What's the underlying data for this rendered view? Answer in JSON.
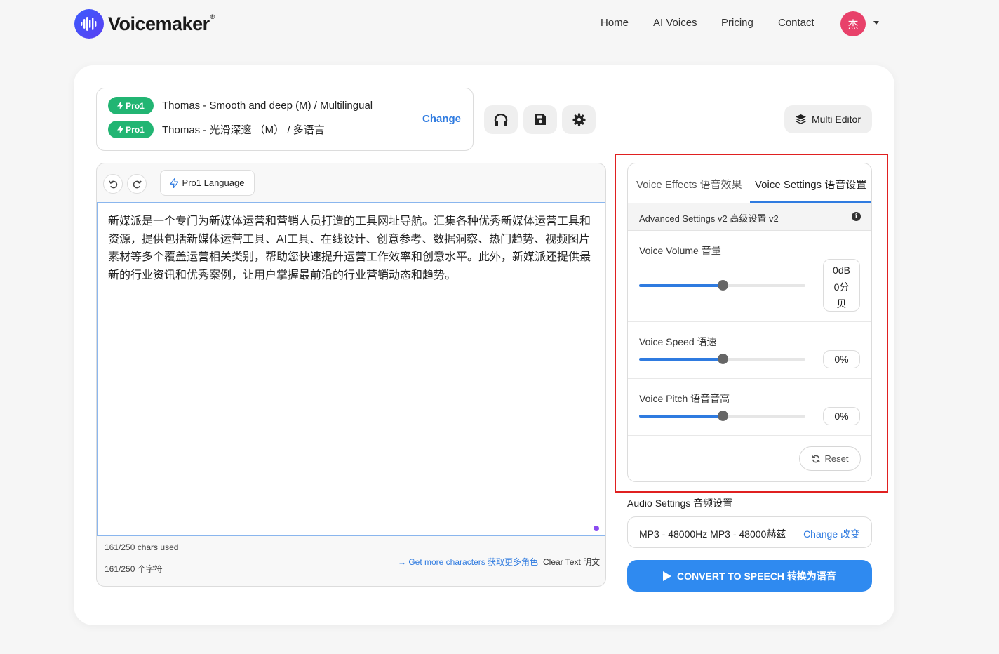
{
  "header": {
    "logo_text": "Voicemaker",
    "logo_reg": "®",
    "nav": [
      "Home",
      "AI Voices",
      "Pricing",
      "Contact"
    ],
    "avatar_initial": "杰"
  },
  "voice": {
    "badge": "Pro1",
    "line1": "Thomas - Smooth and deep (M) / Multilingual",
    "line2": "Thomas - 光滑深邃 （M） / 多语言",
    "change": "Change"
  },
  "toolbar": {
    "multi_editor": "Multi Editor"
  },
  "editor": {
    "language_button": "Pro1 Language",
    "text": "新媒派是一个专门为新媒体运营和营销人员打造的工具网址导航。汇集各种优秀新媒体运营工具和资源，提供包括新媒体运营工具、AI工具、在线设计、创意参考、数据洞察、热门趋势、视频图片素材等多个覆盖运营相关类别，帮助您快速提升运营工作效率和创意水平。此外，新媒派还提供最新的行业资讯和优秀案例，让用户掌握最前沿的行业营销动态和趋势。",
    "chars_used": "161/250 chars used",
    "chars_used_cn": "161/250 个字符",
    "more_chars": "→ Get more characters 获取更多角色",
    "clear_text": "Clear Text 明文"
  },
  "settings": {
    "tab_effects": "Voice Effects 语音效果",
    "tab_settings": "Voice Settings 语音设置",
    "advanced": "Advanced Settings v2 高级设置 v2",
    "info": "i",
    "volume_label": "Voice Volume 音量",
    "volume_value_1": "0dB",
    "volume_value_2": "0分",
    "volume_value_3": "贝",
    "volume_level": 0.5,
    "speed_label": "Voice Speed 语速",
    "speed_value": "0%",
    "speed_level": 0.5,
    "pitch_label": "Voice Pitch 语音音高",
    "pitch_value": "0%",
    "pitch_level": 0.5,
    "reset": "Reset"
  },
  "audio": {
    "label": "Audio Settings 音频设置",
    "format": "MP3 - 48000Hz MP3 - 48000赫兹",
    "change": "Change 改变"
  },
  "convert": "CONVERT TO SPEECH 转换为语音",
  "colors": {
    "accent": "#2f7be0",
    "pro_badge": "#22b573",
    "avatar": "#e8416a",
    "highlight_frame": "#e02020"
  }
}
